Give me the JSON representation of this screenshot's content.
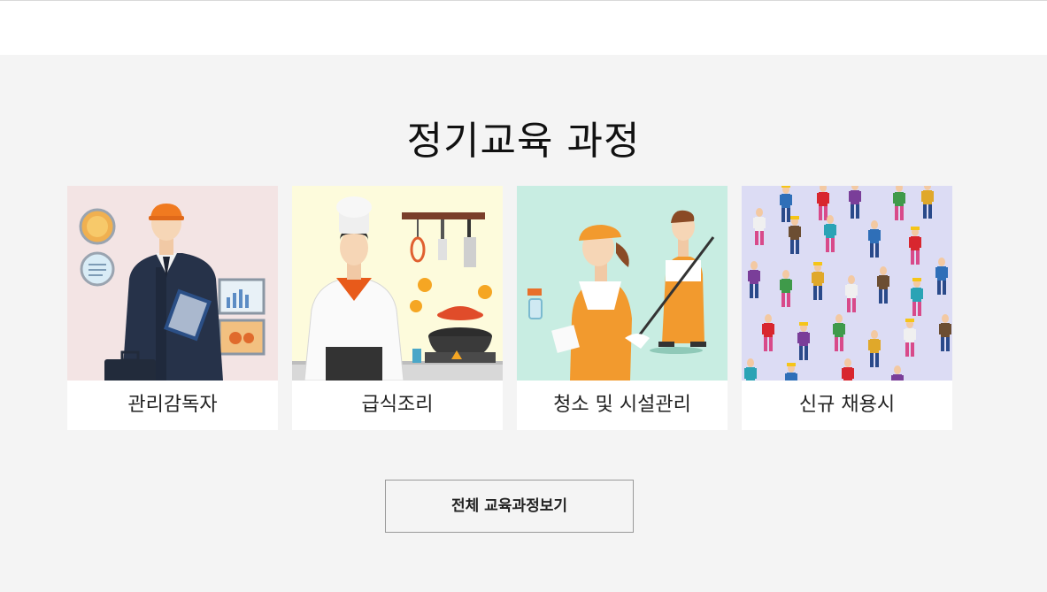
{
  "section": {
    "title": "정기교육 과정"
  },
  "courses": [
    {
      "label": "관리감독자",
      "icon": "supervisor-illustration",
      "bg": "#f3e4e4"
    },
    {
      "label": "급식조리",
      "icon": "chef-illustration",
      "bg": "#fdfbdc"
    },
    {
      "label": "청소 및 시설관리",
      "icon": "cleaning-staff-illustration",
      "bg": "#c8ede2"
    },
    {
      "label": "신규 채용시",
      "icon": "crowd-workers-illustration",
      "bg": "#dcdcf4"
    }
  ],
  "view_all_button": {
    "label": "전체 교육과정보기"
  }
}
